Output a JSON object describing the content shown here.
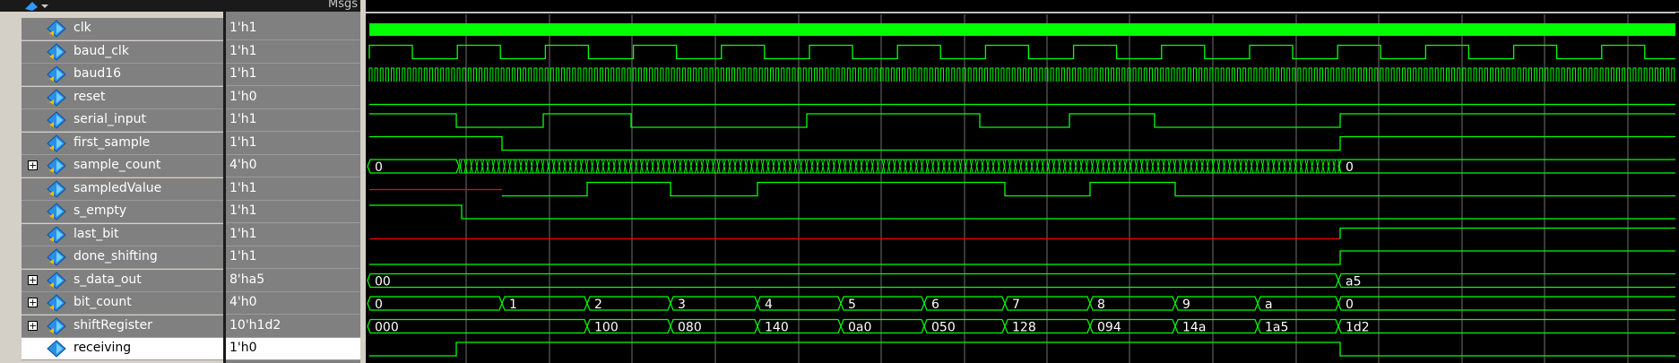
{
  "header": {
    "msgs_label": "Msgs"
  },
  "signals": [
    {
      "name": "clk",
      "value": "1'h1",
      "expandable": false,
      "icon": "signal-icon",
      "selected": false
    },
    {
      "name": "baud_clk",
      "value": "1'h1",
      "expandable": false,
      "icon": "signal-icon",
      "selected": false
    },
    {
      "name": "baud16",
      "value": "1'h1",
      "expandable": false,
      "icon": "signal-icon",
      "selected": false
    },
    {
      "name": "reset",
      "value": "1'h0",
      "expandable": false,
      "icon": "signal-icon",
      "selected": false
    },
    {
      "name": "serial_input",
      "value": "1'h1",
      "expandable": false,
      "icon": "signal-icon",
      "selected": false
    },
    {
      "name": "first_sample",
      "value": "1'h1",
      "expandable": false,
      "icon": "signal-icon",
      "selected": false
    },
    {
      "name": "sample_count",
      "value": "4'h0",
      "expandable": true,
      "icon": "signal-icon",
      "selected": false
    },
    {
      "name": "sampledValue",
      "value": "1'h1",
      "expandable": false,
      "icon": "signal-icon",
      "selected": false
    },
    {
      "name": "s_empty",
      "value": "1'h1",
      "expandable": false,
      "icon": "signal-icon",
      "selected": false
    },
    {
      "name": "last_bit",
      "value": "1'h1",
      "expandable": false,
      "icon": "signal-icon",
      "selected": false
    },
    {
      "name": "done_shifting",
      "value": "1'h1",
      "expandable": false,
      "icon": "signal-icon",
      "selected": false
    },
    {
      "name": "s_data_out",
      "value": "8'ha5",
      "expandable": true,
      "icon": "signal-icon",
      "selected": false
    },
    {
      "name": "bit_count",
      "value": "4'h0",
      "expandable": true,
      "icon": "signal-icon",
      "selected": false
    },
    {
      "name": "shiftRegister",
      "value": "10'h1d2",
      "expandable": true,
      "icon": "signal-icon",
      "selected": false
    },
    {
      "name": "receiving",
      "value": "1'h0",
      "expandable": false,
      "icon": "signal-icon",
      "selected": true
    }
  ],
  "bus_labels": {
    "sample_count": [
      "0",
      "0"
    ],
    "s_data_out": [
      "00",
      "a5"
    ],
    "bit_count": [
      "0",
      "1",
      "2",
      "3",
      "4",
      "5",
      "6",
      "7",
      "8",
      "9",
      "a",
      "0"
    ],
    "shiftRegister": [
      "000",
      "100",
      "080",
      "140",
      "0a0",
      "050",
      "128",
      "094",
      "14a",
      "1a5",
      "1d2"
    ]
  },
  "colors": {
    "wave": "#00ff00",
    "undefined": "#ff0000",
    "grid": "#707070",
    "text": "#ffffff"
  }
}
